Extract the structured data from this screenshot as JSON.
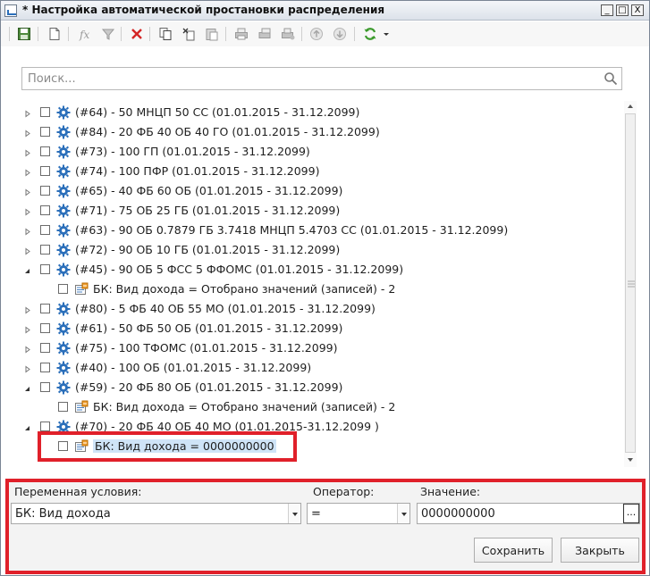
{
  "window": {
    "title": "* Настройка автоматической простановки распределения",
    "controls": {
      "minimize": "_",
      "maximize": "□",
      "close": "X"
    }
  },
  "toolbar": {
    "icons": [
      "save-icon",
      "new-document-icon",
      "formula-icon",
      "filter-icon",
      "delete-icon",
      "copy-icon",
      "cut-icon",
      "paste-icon",
      "print-icon",
      "print-preview-icon",
      "print-settings-icon",
      "move-up-icon",
      "move-down-icon",
      "refresh-icon",
      "dropdown-arrow-icon"
    ]
  },
  "search": {
    "placeholder": "Поиск...",
    "value": ""
  },
  "tree": {
    "rows": [
      {
        "level": 0,
        "expanded": false,
        "label": "(#64) - 50 МНЦП 50 СС (01.01.2015 - 31.12.2099)"
      },
      {
        "level": 0,
        "expanded": false,
        "label": "(#84) - 20 ФБ 40 ОБ 40 ГО (01.01.2015 - 31.12.2099)"
      },
      {
        "level": 0,
        "expanded": false,
        "label": "(#73) - 100 ГП (01.01.2015 - 31.12.2099)"
      },
      {
        "level": 0,
        "expanded": false,
        "label": "(#74) - 100 ПФР (01.01.2015 - 31.12.2099)"
      },
      {
        "level": 0,
        "expanded": false,
        "label": "(#65) - 40 ФБ 60 ОБ (01.01.2015 - 31.12.2099)"
      },
      {
        "level": 0,
        "expanded": false,
        "label": "(#71) - 75 ОБ 25 ГБ (01.01.2015 - 31.12.2099)"
      },
      {
        "level": 0,
        "expanded": false,
        "label": "(#63) - 90 ОБ 0.7879 ГБ 3.7418 МНЦП 5.4703 СС (01.01.2015 - 31.12.2099)"
      },
      {
        "level": 0,
        "expanded": false,
        "label": "(#72) - 90 ОБ 10 ГБ (01.01.2015 - 31.12.2099)"
      },
      {
        "level": 0,
        "expanded": true,
        "label": "(#45) - 90 ОБ 5 ФСС 5 ФФОМС (01.01.2015 - 31.12.2099)"
      },
      {
        "level": 1,
        "expanded": null,
        "label": "БК: Вид дохода = Отобрано значений (записей) - 2"
      },
      {
        "level": 0,
        "expanded": false,
        "label": "(#80) - 5 ФБ 40 ОБ 55 МО (01.01.2015 - 31.12.2099)"
      },
      {
        "level": 0,
        "expanded": false,
        "label": "(#61) - 50 ФБ 50 ОБ (01.01.2015 - 31.12.2099)"
      },
      {
        "level": 0,
        "expanded": false,
        "label": "(#75) - 100 ТФОМС (01.01.2015 - 31.12.2099)"
      },
      {
        "level": 0,
        "expanded": false,
        "label": "(#40) - 100 ОБ (01.01.2015 - 31.12.2099)"
      },
      {
        "level": 0,
        "expanded": true,
        "label": "(#59) - 20 ФБ 80 ОБ (01.01.2015 - 31.12.2099)"
      },
      {
        "level": 1,
        "expanded": null,
        "label": "БК: Вид дохода = Отобрано значений (записей) - 2"
      },
      {
        "level": 0,
        "expanded": true,
        "label": "(#70) - 20 ФБ 40 ОБ 40 МО (01.01.2015-31.12.2099 )"
      },
      {
        "level": 1,
        "expanded": null,
        "label": "БК: Вид дохода = 0000000000",
        "selected": true
      }
    ]
  },
  "editor": {
    "variable_label": "Переменная условия:",
    "variable_value": "БК: Вид дохода",
    "operator_label": "Оператор:",
    "operator_value": "=",
    "value_label": "Значение:",
    "value_value": "0000000000",
    "ellipsis_label": "...",
    "save_label": "Сохранить",
    "close_label": "Закрыть"
  },
  "colors": {
    "highlight": "#e0202a",
    "selection": "#cfe4f7",
    "gear": "#2b6fba"
  }
}
